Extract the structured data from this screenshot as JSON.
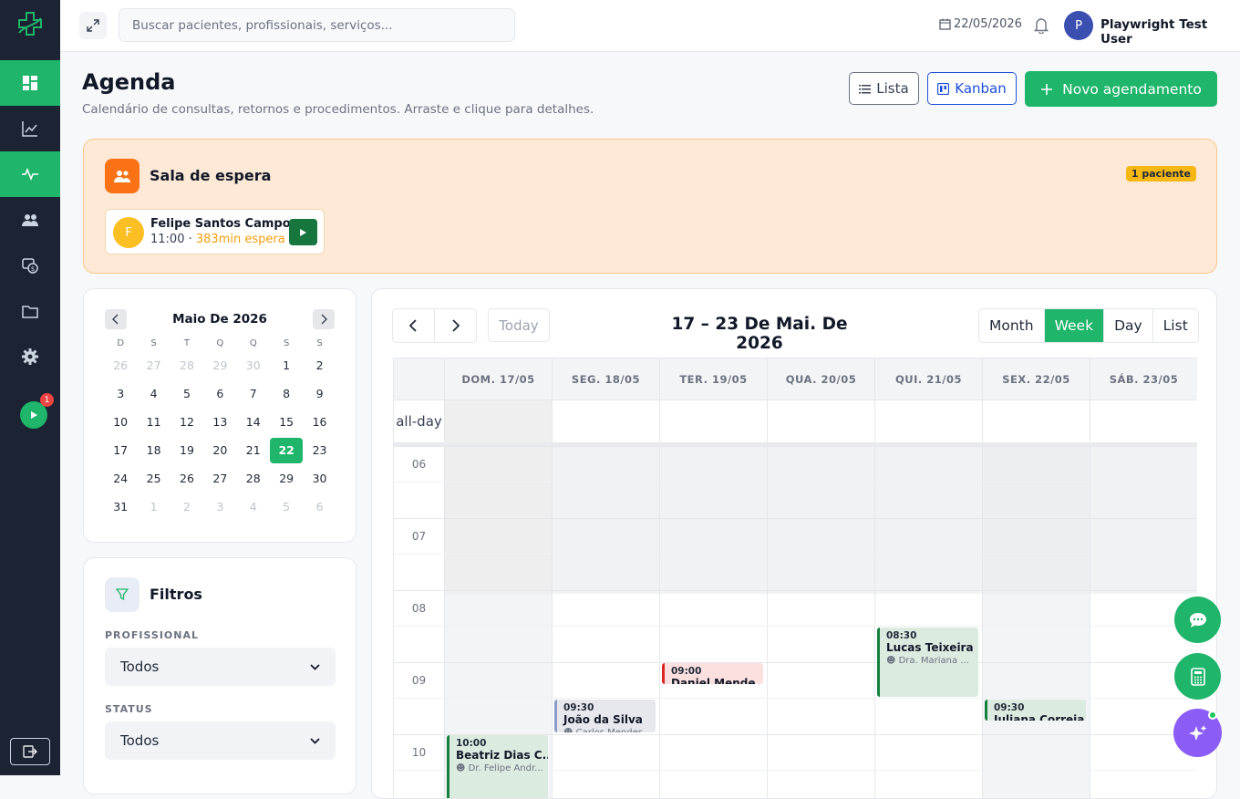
{
  "topbar": {
    "search_placeholder": "Buscar pacientes, profissionais, serviços...",
    "date": "22/05/2026",
    "avatar_initial": "P",
    "user_name": "Playwright Test User"
  },
  "sidebar": {
    "items": [
      {
        "name": "dashboard",
        "icon": "dashboard-icon",
        "active": true
      },
      {
        "name": "reports",
        "icon": "chart-line-icon",
        "active": false
      },
      {
        "name": "agenda",
        "icon": "activity-icon",
        "active": true
      },
      {
        "name": "patients",
        "icon": "users-icon",
        "active": false
      },
      {
        "name": "finance",
        "icon": "money-icon",
        "active": false
      },
      {
        "name": "files",
        "icon": "folder-icon",
        "active": false
      },
      {
        "name": "settings",
        "icon": "gear-icon",
        "active": false
      }
    ],
    "play_badge": "1"
  },
  "header": {
    "title": "Agenda",
    "subtitle": "Calendário de consultas, retornos e procedimentos. Arraste e clique para detalhes.",
    "lista_label": "Lista",
    "kanban_label": "Kanban",
    "novo_label": "Novo agendamento"
  },
  "waiting_room": {
    "title": "Sala de espera",
    "badge": "1 paciente",
    "patient": {
      "initial": "F",
      "name": "Felipe Santos Campos",
      "time": "11:00 · ",
      "wait": "383min espera"
    }
  },
  "mini_calendar": {
    "title": "Maio De 2026",
    "weekdays": [
      "D",
      "S",
      "T",
      "Q",
      "Q",
      "S",
      "S"
    ],
    "weeks": [
      [
        "26",
        "27",
        "28",
        "29",
        "30",
        "1",
        "2"
      ],
      [
        "3",
        "4",
        "5",
        "6",
        "7",
        "8",
        "9"
      ],
      [
        "10",
        "11",
        "12",
        "13",
        "14",
        "15",
        "16"
      ],
      [
        "17",
        "18",
        "19",
        "20",
        "21",
        "22",
        "23"
      ],
      [
        "24",
        "25",
        "26",
        "27",
        "28",
        "29",
        "30"
      ],
      [
        "31",
        "1",
        "2",
        "3",
        "4",
        "5",
        "6"
      ]
    ],
    "selected": "22"
  },
  "filters": {
    "title": "Filtros",
    "profissional_label": "PROFISSIONAL",
    "profissional_value": "Todos",
    "status_label": "STATUS",
    "status_value": "Todos"
  },
  "calendar": {
    "today_label": "Today",
    "title": "17 – 23 De Mai. De 2026",
    "views": [
      "Month",
      "Week",
      "Day",
      "List"
    ],
    "active_view": "Week",
    "allday_label": "all-day",
    "days": [
      "DOM. 17/05",
      "SEG. 18/05",
      "TER. 19/05",
      "QUA. 20/05",
      "QUI. 21/05",
      "SEX. 22/05",
      "SÁB. 23/05"
    ],
    "hours": [
      "06",
      "07",
      "08",
      "09",
      "10"
    ],
    "events": [
      {
        "day": 4,
        "start": "08:30",
        "end": "09:30",
        "time": "08:30",
        "name": "Lucas Teixeira ...",
        "detail": "Dra. Mariana ...",
        "bg": "#dcebe0",
        "border": "#15803d"
      },
      {
        "day": 2,
        "start": "09:00",
        "end": "09:20",
        "time": "09:00",
        "name": "Daniel Mende...",
        "detail": "",
        "bg": "#fbe0df",
        "border": "#dc2626"
      },
      {
        "day": 1,
        "start": "09:30",
        "end": "10:00",
        "time": "09:30",
        "name": "João da Silva",
        "detail": "Carlos Mendes",
        "bg": "#e7e8ee",
        "border": "#8b9bc9"
      },
      {
        "day": 5,
        "start": "09:30",
        "end": "09:50",
        "time": "09:30",
        "name": "Juliana Correia",
        "detail": "",
        "bg": "#dcebe0",
        "border": "#15803d"
      },
      {
        "day": 0,
        "start": "10:00",
        "end": "11:00",
        "time": "10:00",
        "name": "Beatriz Dias C...",
        "detail": "Dr. Felipe Andr...",
        "bg": "#dcebe0",
        "border": "#15803d"
      }
    ]
  },
  "colors": {
    "accent": "#1fb56a",
    "sidebar": "#1c2333",
    "waiting": "#fde9d6"
  }
}
